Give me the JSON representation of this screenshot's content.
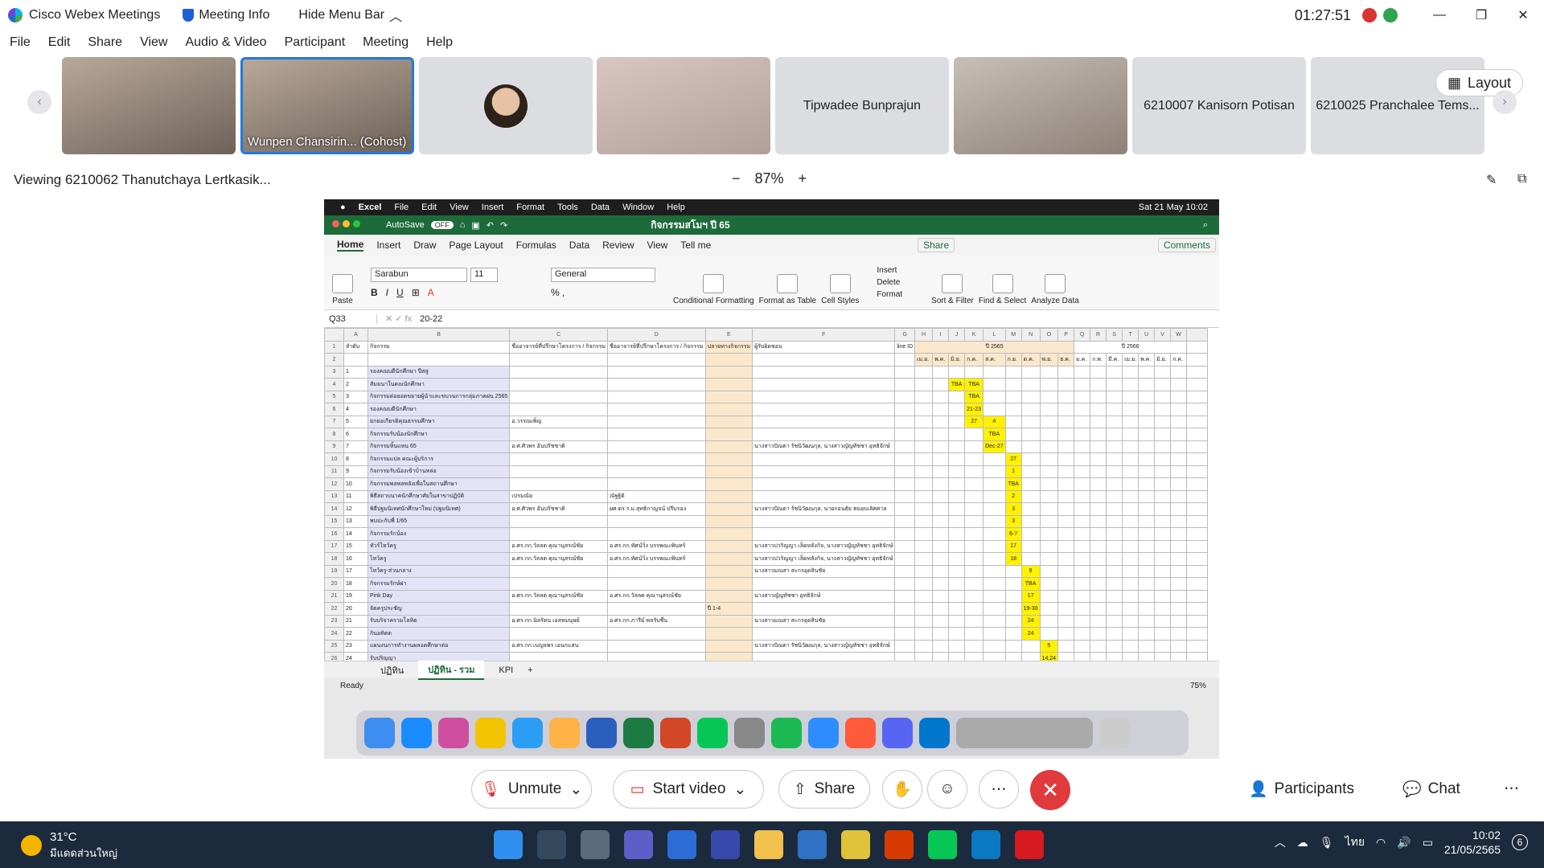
{
  "window": {
    "app_title": "Cisco Webex Meetings",
    "meeting_info": "Meeting Info",
    "hide_menu": "Hide Menu Bar",
    "clock": "01:27:51"
  },
  "menu": [
    "File",
    "Edit",
    "Share",
    "View",
    "Audio & Video",
    "Participant",
    "Meeting",
    "Help"
  ],
  "participants": [
    {
      "name": "",
      "type": "video"
    },
    {
      "name": "Wunpen Chansirin... (Cohost)",
      "type": "video"
    },
    {
      "name": "",
      "type": "avatar"
    },
    {
      "name": "",
      "type": "video"
    },
    {
      "name": "Tipwadee Bunprajun",
      "type": "name"
    },
    {
      "name": "",
      "type": "video"
    },
    {
      "name": "6210007 Kanisorn Potisan",
      "type": "name"
    },
    {
      "name": "6210025 Pranchalee Tems...",
      "type": "name"
    }
  ],
  "layout_label": "Layout",
  "viewing": "Viewing 6210062 Thanutchaya Lertkasik...",
  "zoom": {
    "minus": "−",
    "value": "87%",
    "plus": "+"
  },
  "mac": {
    "menubar": [
      "Excel",
      "File",
      "Edit",
      "View",
      "Insert",
      "Format",
      "Tools",
      "Data",
      "Window",
      "Help"
    ],
    "datetime": "Sat 21 May  10:02",
    "autosave": "AutoSave",
    "autosave_state": "OFF",
    "doc_title": "กิจกรรมสโมฯ ปี 65",
    "tabs": [
      "Home",
      "Insert",
      "Draw",
      "Page Layout",
      "Formulas",
      "Data",
      "Review",
      "View",
      "Tell me"
    ],
    "share": "Share",
    "comments": "Comments",
    "font": "Sarabun",
    "font_size": "11",
    "number_format": "General",
    "ribbon_groups": [
      "Paste",
      "Conditional Formatting",
      "Format as Table",
      "Cell Styles",
      "Insert",
      "Delete",
      "Format",
      "Sort & Filter",
      "Find & Select",
      "Analyze Data"
    ],
    "name_box": "Q33",
    "formula": "20-22",
    "sheet_tabs": [
      "ปฏิทิน",
      "ปฏิทิน - รวม",
      "KPI"
    ],
    "status": "Ready",
    "zoom": "75%",
    "year1": "ปี 2565",
    "year2": "ปี 2566",
    "months": [
      "เม.ย.",
      "พ.ค.",
      "มิ.ย.",
      "ก.ค.",
      "ส.ค.",
      "ก.ย.",
      "ต.ค.",
      "พ.ย.",
      "ธ.ค.",
      "ม.ค.",
      "ก.พ.",
      "มี.ค.",
      "เม.ย.",
      "พ.ค.",
      "มิ.ย.",
      "ก.ค."
    ],
    "col_headers": [
      "A",
      "B",
      "C",
      "D",
      "E",
      "F",
      "G",
      "H",
      "I",
      "J",
      "K",
      "L",
      "M",
      "N",
      "O",
      "P",
      "Q",
      "R",
      "S",
      "T",
      "U",
      "V",
      "W"
    ],
    "header_row": [
      "ลำดับ",
      "กิจกรรม",
      "ชื่ออาจารย์ที่ปรึกษาโครงการ / กิจกรรม",
      "ชื่ออาจารย์ที่ปรึกษาโครงการ / กิจกรรม",
      "ปลายทางกิจกรรม",
      "ผู้รับผิดชอบ",
      "line ID"
    ],
    "rows": [
      {
        "n": "1",
        "act": "รองคณบดีนักศึกษา ปีสสู",
        "c": "",
        "d": "",
        "e": "",
        "f": "",
        "m": {}
      },
      {
        "n": "2",
        "act": "สัมมนาในคณนักศึกษา",
        "c": "",
        "d": "",
        "e": "",
        "f": "",
        "m": {
          "2": "TBA",
          "3": "TBA"
        }
      },
      {
        "n": "3",
        "act": "กิจกรรมต่อยอดขยายผู้นำและขบวนการกลุ่มภาคฝน 2565",
        "c": "",
        "d": "",
        "e": "",
        "f": "",
        "m": {
          "3": "TBA"
        }
      },
      {
        "n": "4",
        "act": "รองคณบดีนักศึกษา",
        "c": "",
        "d": "",
        "e": "",
        "f": "",
        "m": {
          "3": "21-23"
        }
      },
      {
        "n": "5",
        "act": "ยกยอเกียรติคุณธรรมศึกษา",
        "c": "อ.วรรณเพ็ญ",
        "d": "",
        "e": "",
        "f": "",
        "m": {
          "3": "27",
          "4": "4"
        }
      },
      {
        "n": "6",
        "act": "กิจกรรมรับน้องนักศึกษา",
        "c": "",
        "d": "",
        "e": "",
        "f": "",
        "m": {
          "4": "TBA"
        }
      },
      {
        "n": "7",
        "act": "กิจกรรมหิ้นแหน 65",
        "c": "อ.ศ.ศิวพร อันปรัชชาติ",
        "d": "",
        "e": "",
        "f": "นางสาวปัณตา รัชนิวัฒนกุล, นางสาวญัญทัชชา อุทธิจักษ์",
        "m": {
          "4": "Dec-27"
        }
      },
      {
        "n": "8",
        "act": "กิจกรรมแปล คณะผู้บริการ",
        "c": "",
        "d": "",
        "e": "",
        "f": "",
        "m": {
          "5": "27"
        }
      },
      {
        "n": "9",
        "act": "กิจกรรมรับน้องเข้าบ้านหล่อ",
        "c": "",
        "d": "",
        "e": "",
        "f": "",
        "m": {
          "5": "1"
        }
      },
      {
        "n": "10",
        "act": "กิจกรรมพลพลพลังเพื่อในสถานศึกษา",
        "c": "",
        "d": "",
        "e": "",
        "f": "",
        "m": {
          "5": "TBA"
        }
      },
      {
        "n": "11",
        "act": "พิธีสถาบนาคนักศึกษาศัยในสาขาปฏิบัติ",
        "c": "เปรมณัย",
        "d": "ณัฐฐิติ",
        "e": "",
        "f": "",
        "m": {
          "5": "2"
        }
      },
      {
        "n": "12",
        "act": "พิธีปฐมนิเทศนักศึกษาใหม่ (ปฐมนิเทศ)",
        "c": "อ.ศ.ศิวพร อันปรัชชาติ",
        "d": "ผศ.ดร.ร.ม.สุทธิกาญจน์ ปรีบรอง",
        "e": "",
        "f": "นางสาวปัณตา รัชนิวัฒนกุล, นายกอนธัย หมอบเลิศศาล",
        "m": {
          "5": "3"
        }
      },
      {
        "n": "13",
        "act": "พบปะกับพี่ 1/65",
        "c": "",
        "d": "",
        "e": "",
        "f": "",
        "m": {
          "5": "3"
        }
      },
      {
        "n": "14",
        "act": "กิจกรรมรักน้อง",
        "c": "",
        "d": "",
        "e": "",
        "f": "",
        "m": {
          "5": "6-7"
        }
      },
      {
        "n": "15",
        "act": "ทัวร์ไหว้ครู",
        "c": "อ.ศร.กก.วัลลต คุณานุสรณ์ชัย",
        "d": "อ.ศร.กก.ทัศน์วิ่ง บรรพณะพินทร์",
        "e": "",
        "f": "นางสาวปวริญญา เล็ดหลังกิจ, นางสาวญัญทัชชา อุทธิจักษ์",
        "m": {
          "5": "17"
        }
      },
      {
        "n": "16",
        "act": "ไหว้ครู",
        "c": "อ.ศร.กก.วัลลต คุณานุสรณ์ชัย",
        "d": "อ.ศร.กก.ทัศน์วิ่ง บรรพณะพินทร์",
        "e": "",
        "f": "นางสาวปวริญญา เล็ดหลังกิจ, นางสาวญัญทัชชา อุทธิจักษ์",
        "m": {
          "5": "18"
        }
      },
      {
        "n": "17",
        "act": "ไหว้ครู-ส่วนกลาง",
        "c": "",
        "d": "",
        "e": "",
        "f": "นางสาวมณสา สะกรอุดสินชัย",
        "m": {
          "6": "8"
        }
      },
      {
        "n": "18",
        "act": "กิจกรรมรักษ์ฝา",
        "c": "",
        "d": "",
        "e": "",
        "f": "",
        "m": {
          "6": "TBA"
        }
      },
      {
        "n": "19",
        "act": "Pink Day",
        "c": "อ.ศร.กก.วัลลต คุณานุสรณ์ชัย",
        "d": "อ.ศร.กก.วัลลต คุณานุสรณ์ชัย",
        "e": "",
        "f": "นางสาวญัญทัชชา อุทธิจักษ์",
        "m": {
          "6": "17"
        }
      },
      {
        "n": "20",
        "act": "จัดครูประชัญ",
        "c": "",
        "d": "",
        "e": "ปี 1-4",
        "f": "",
        "m": {
          "6": "19-30"
        }
      },
      {
        "n": "21",
        "act": "รับบริจาครวมโลหิต",
        "c": "อ.ศร.กก.นิลรัตน เอสหมนุษย์",
        "d": "อ.ศร.กก.ภารีม์ พลรับชื่น",
        "e": "",
        "f": "นางสาวมณสา สะกรอุดสินชัย",
        "m": {
          "6": "24"
        }
      },
      {
        "n": "22",
        "act": "กินอทิตต",
        "c": "",
        "d": "",
        "e": "",
        "f": "",
        "m": {
          "6": "24"
        }
      },
      {
        "n": "23",
        "act": "แผนงนการทำงานผลอดศึกษาต่อ",
        "c": "อ.ศร.กก.เบญจพร เอนกแสน",
        "d": "",
        "e": "",
        "f": "นางสาวปัณตา รัชนิวัฒนกุล, นางสาวญัญทัชชา อุทธิจักษ์",
        "m": {
          "7": "5"
        }
      },
      {
        "n": "24",
        "act": "รับปริญญา",
        "c": "",
        "d": "",
        "e": "",
        "f": "",
        "m": {
          "7": "14,24"
        }
      }
    ]
  },
  "controls": {
    "unmute": "Unmute",
    "start_video": "Start video",
    "share": "Share",
    "participants": "Participants",
    "chat": "Chat"
  },
  "taskbar": {
    "temp": "31°C",
    "weather": "มีแดดส่วนใหญ่",
    "lang": "ไทย",
    "time": "10:02",
    "date": "21/05/2565",
    "badge": "6"
  }
}
